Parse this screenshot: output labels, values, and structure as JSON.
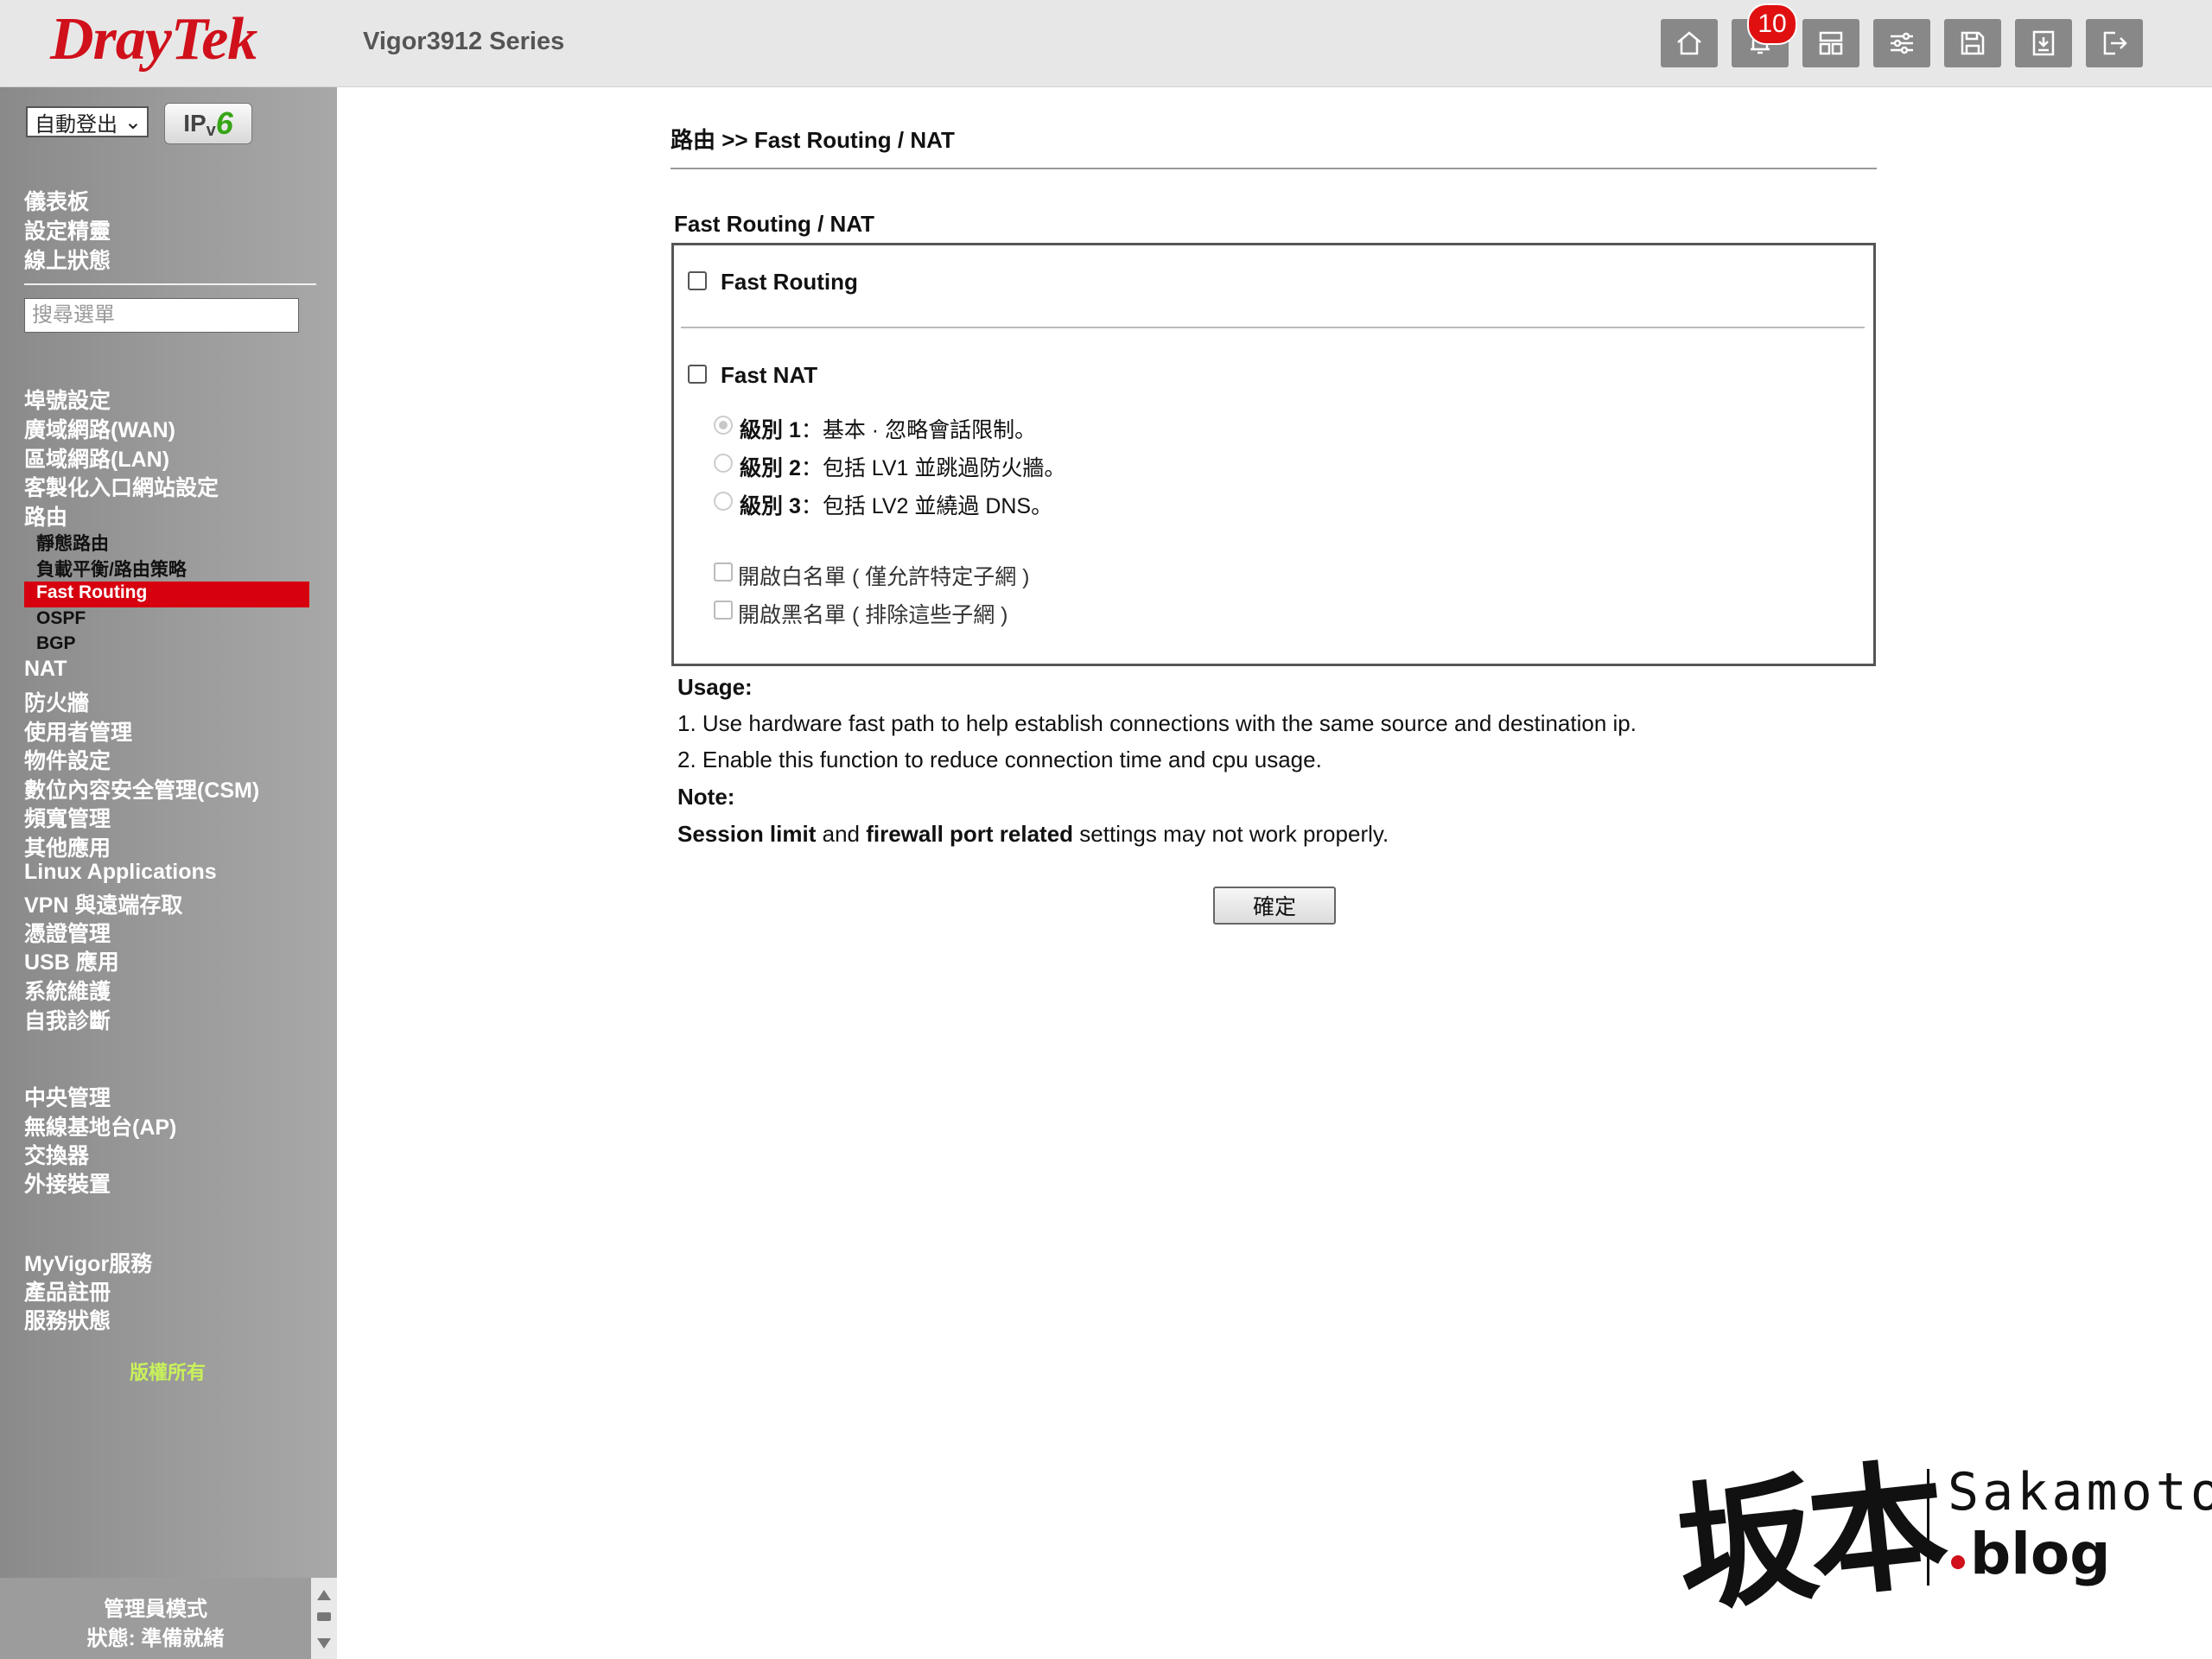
{
  "header": {
    "brand": "DrayTek",
    "model": "Vigor3912 Series",
    "notification_count": "10",
    "buttons": [
      "home-icon",
      "bell-icon",
      "layout-icon",
      "sliders-icon",
      "save-icon",
      "backup-icon",
      "logout-icon"
    ]
  },
  "sidebar": {
    "logout_select": "自動登出",
    "ipv6_prefix": "IP",
    "ipv6_v": "v",
    "ipv6_six": "6",
    "top_links": [
      "儀表板",
      "設定精靈",
      "線上狀態"
    ],
    "search_placeholder": "搜尋選單",
    "menu": [
      "埠號設定",
      "廣域網路(WAN)",
      "區域網路(LAN)",
      "客製化入口網站設定",
      "路由"
    ],
    "routing_sub": [
      "靜態路由",
      "負載平衡/路由策略"
    ],
    "active_item": "Fast Routing",
    "routing_sub_after": [
      "OSPF",
      "BGP"
    ],
    "menu2": [
      "NAT",
      "防火牆",
      "使用者管理",
      "物件設定",
      "數位內容安全管理(CSM)",
      "頻寬管理",
      "其他應用",
      "Linux Applications",
      "VPN 與遠端存取",
      "憑證管理",
      "USB 應用",
      "系統維護",
      "自我診斷"
    ],
    "menu3": [
      "中央管理",
      "無線基地台(AP)",
      "交換器",
      "外接裝置"
    ],
    "menu4": [
      "MyVigor服務",
      "產品註冊",
      "服務狀態"
    ],
    "copyright": "版權所有",
    "footer_mode": "管理員模式",
    "footer_status": "狀態: 準備就緒"
  },
  "main": {
    "breadcrumb": "路由 >> Fast Routing / NAT",
    "section_title": "Fast Routing / NAT",
    "fast_routing_label": "Fast Routing",
    "fast_nat_label": "Fast NAT",
    "levels": [
      {
        "name": "級別 1",
        "desc": "：基本 · 忽略會話限制。",
        "selected": true
      },
      {
        "name": "級別 2",
        "desc": "：包括 LV1 並跳過防火牆。",
        "selected": false
      },
      {
        "name": "級別 3",
        "desc": "：包括 LV2 並繞過 DNS。",
        "selected": false
      }
    ],
    "whitelist_label": "開啟白名單 ( 僅允許特定子網 )",
    "blacklist_label": "開啟黑名單 ( 排除這些子網 )",
    "usage_title": "Usage:",
    "usage_1": "1. Use hardware fast path to help establish connections with the same source and destination ip.",
    "usage_2": "2. Enable this function to reduce connection time and cpu usage.",
    "note_title": "Note:",
    "note_b1": "Session limit",
    "note_t1": " and ",
    "note_b2": "firewall port related",
    "note_t2": " settings may not work properly.",
    "ok_button": "確定"
  },
  "watermark": {
    "cjk": "坂本",
    "en": "Sakamoto",
    "blog": "blog"
  }
}
